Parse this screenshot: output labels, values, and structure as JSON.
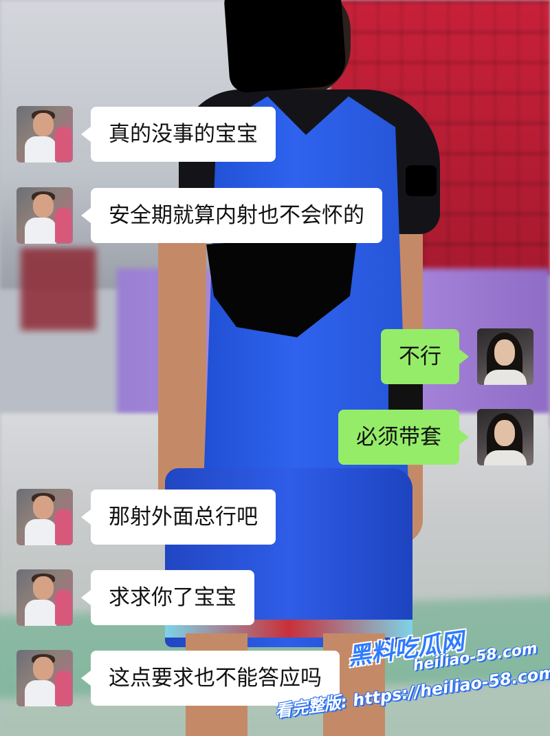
{
  "messages": [
    {
      "side": "left",
      "sender": "him",
      "text": "真的没事的宝宝"
    },
    {
      "side": "left",
      "sender": "him",
      "text": "安全期就算内射也不会怀的"
    },
    {
      "side": "right",
      "sender": "her",
      "text": "不行"
    },
    {
      "side": "right",
      "sender": "her",
      "text": "必须带套"
    },
    {
      "side": "left",
      "sender": "him",
      "text": "那射外面总行吧"
    },
    {
      "side": "left",
      "sender": "him",
      "text": "求求你了宝宝"
    },
    {
      "side": "left",
      "sender": "him",
      "text": "这点要求也不能答应吗"
    }
  ],
  "watermark": {
    "logo": "黑料吃瓜网",
    "domain": "heiliao-58.com",
    "full_label": "看完整版: https://heiliao-58.com"
  },
  "colors": {
    "outgoing_bubble": "#95ec69",
    "incoming_bubble": "#ffffff",
    "watermark_blue": "#2f7bff"
  }
}
